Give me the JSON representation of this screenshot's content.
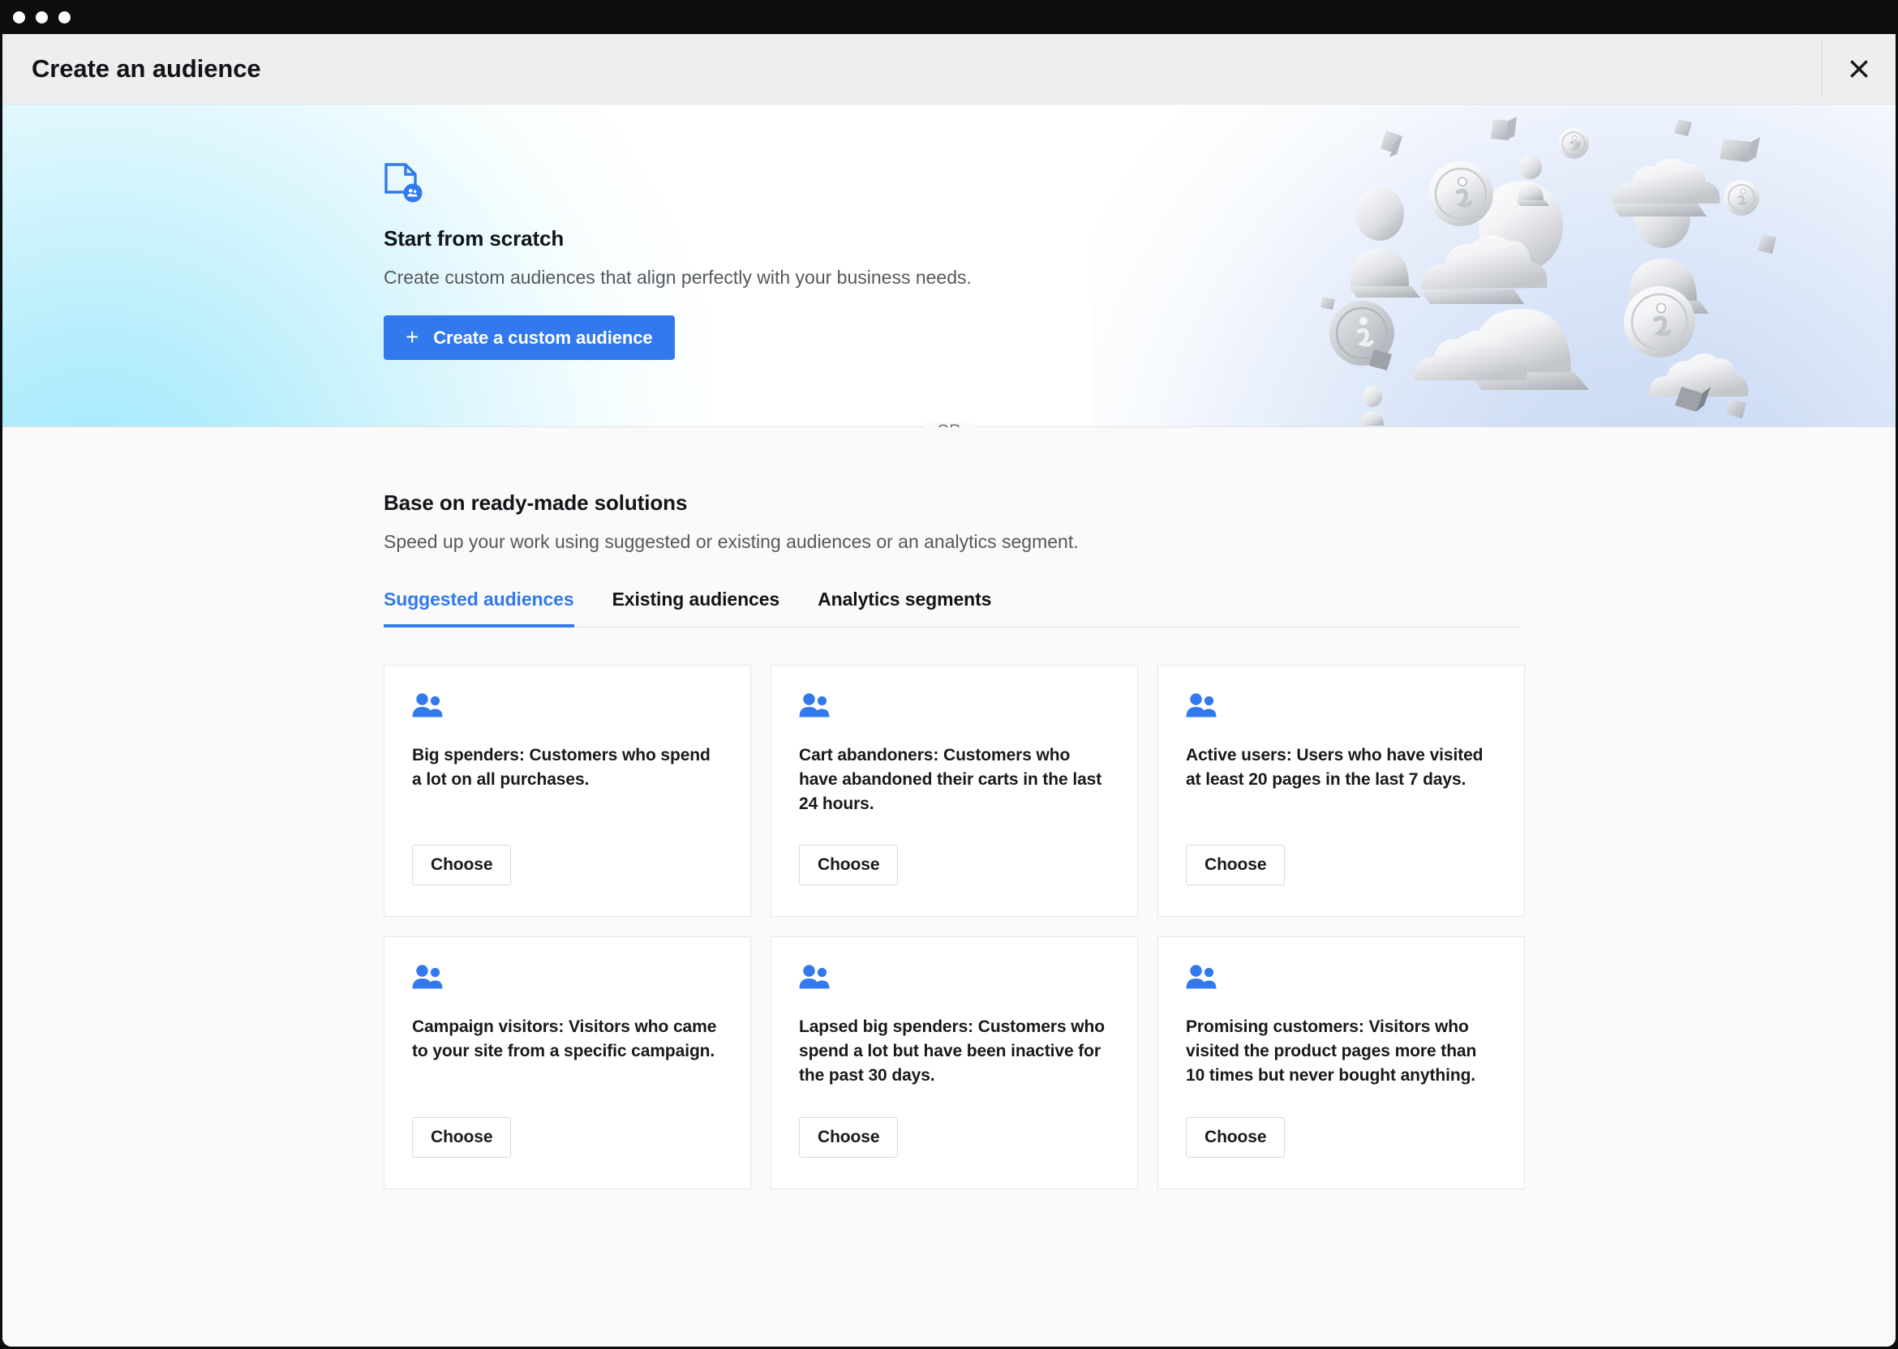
{
  "window": {
    "traffic_lights": [
      "close",
      "minimize",
      "maximize"
    ]
  },
  "modal": {
    "title": "Create an audience",
    "close_icon": "close-icon"
  },
  "hero": {
    "icon": "document-add-people-icon",
    "heading": "Start from scratch",
    "description": "Create custom audiences that align perfectly with your business needs.",
    "primary_button": {
      "label": "Create a custom audience",
      "plus": "+",
      "color": "#3179ed"
    },
    "illustration": "3d-people-cloud-info-icons-illustration"
  },
  "divider": {
    "label": "OR"
  },
  "section": {
    "heading": "Base on ready-made solutions",
    "description": "Speed up your work using suggested or existing audiences or an analytics segment.",
    "tabs": [
      {
        "label": "Suggested audiences",
        "active": true
      },
      {
        "label": "Existing audiences",
        "active": false
      },
      {
        "label": "Analytics segments",
        "active": false
      }
    ],
    "active_tab_color": "#3179ed"
  },
  "cards": [
    {
      "icon": "people-group-icon",
      "text": "Big spenders: Customers who spend a lot on all purchases.",
      "button": "Choose"
    },
    {
      "icon": "people-group-icon",
      "text": "Cart abandoners: Customers who have abandoned their carts in the last 24 hours.",
      "button": "Choose"
    },
    {
      "icon": "people-group-icon",
      "text": "Active users: Users who have visited at least 20 pages in the last 7 days.",
      "button": "Choose"
    },
    {
      "icon": "people-group-icon",
      "text": "Campaign visitors: Visitors who came to your site from a specific campaign.",
      "button": "Choose"
    },
    {
      "icon": "people-group-icon",
      "text": "Lapsed big spenders: Customers who spend a lot but have been inactive for the past 30 days.",
      "button": "Choose"
    },
    {
      "icon": "people-group-icon",
      "text": "Promising customers: Visitors who visited the product pages more than 10 times but never bought anything.",
      "button": "Choose"
    }
  ]
}
